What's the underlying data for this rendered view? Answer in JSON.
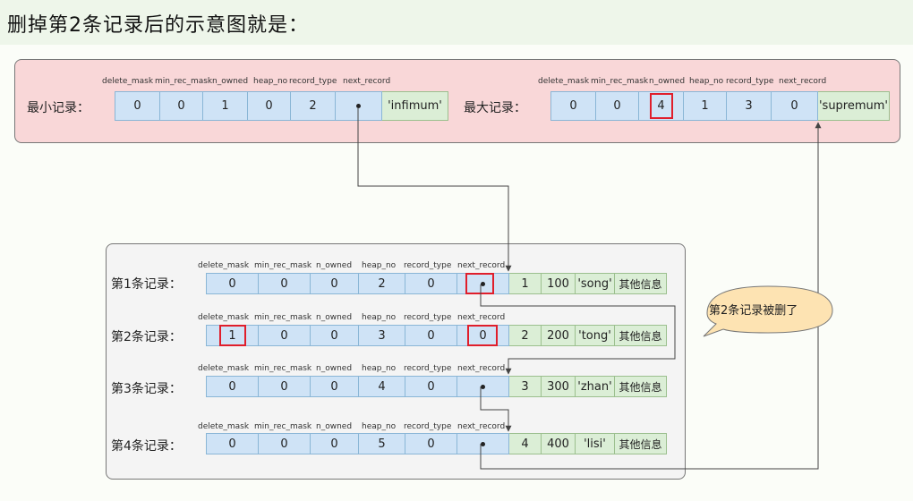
{
  "title": "删掉第2条记录后的示意图就是：",
  "headers": [
    "delete_mask",
    "min_rec_mask",
    "n_owned",
    "heap_no",
    "record_type",
    "next_record"
  ],
  "infimum": {
    "label": "最小记录：",
    "values": [
      "0",
      "0",
      "1",
      "0",
      "2",
      ""
    ],
    "tag": "'infimum'"
  },
  "supremum": {
    "label": "最大记录：",
    "values": [
      "0",
      "0",
      "4",
      "1",
      "3",
      "0"
    ],
    "tag": "'supremum'"
  },
  "records": [
    {
      "label": "第1条记录：",
      "values": [
        "0",
        "0",
        "0",
        "2",
        "0",
        ""
      ],
      "extra": [
        "1",
        "100",
        "'song'",
        "其他信息"
      ]
    },
    {
      "label": "第2条记录：",
      "values": [
        "1",
        "0",
        "0",
        "3",
        "0",
        "0"
      ],
      "extra": [
        "2",
        "200",
        "'tong'",
        "其他信息"
      ]
    },
    {
      "label": "第3条记录：",
      "values": [
        "0",
        "0",
        "0",
        "4",
        "0",
        ""
      ],
      "extra": [
        "3",
        "300",
        "'zhan'",
        "其他信息"
      ]
    },
    {
      "label": "第4条记录：",
      "values": [
        "0",
        "0",
        "0",
        "5",
        "0",
        ""
      ],
      "extra": [
        "4",
        "400",
        "'lisi'",
        "其他信息"
      ]
    }
  ],
  "callout": "第2条记录被删了",
  "colors": {
    "highlight": "#e01e2b",
    "header_panel": "#f9d7d8",
    "blue_cell": "#cfe3f6",
    "green_cell": "#dbeed6"
  }
}
